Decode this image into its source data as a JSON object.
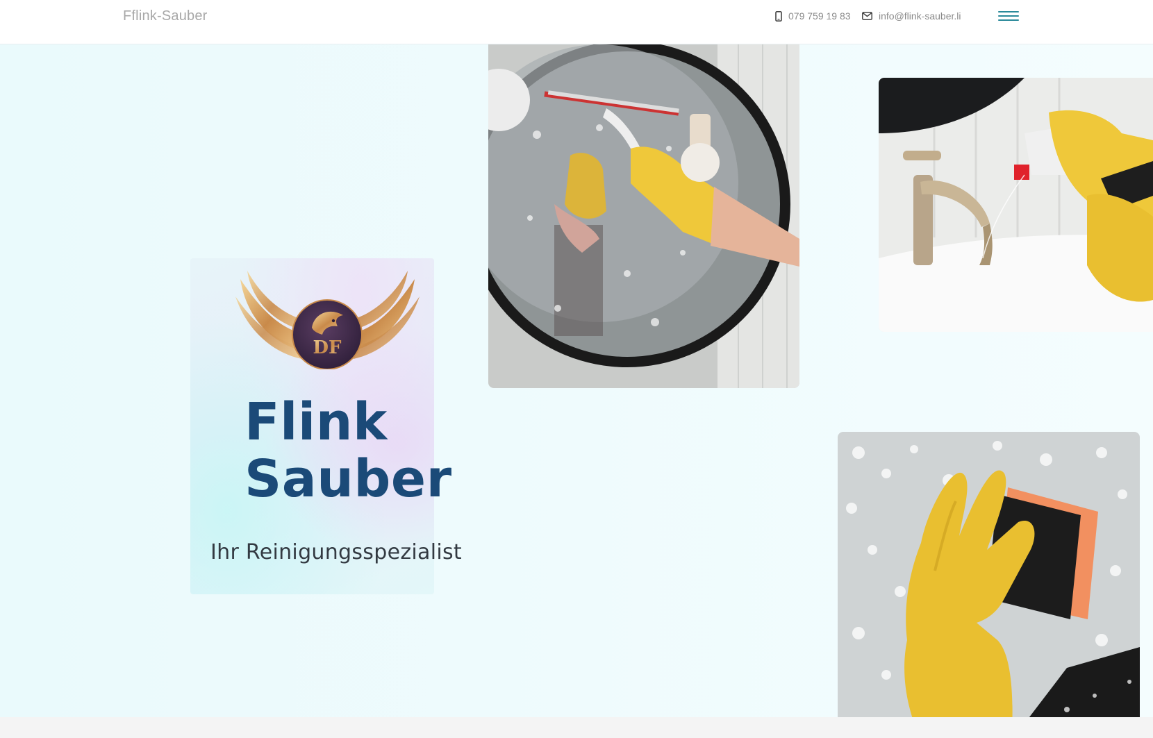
{
  "header": {
    "brand": "Fflink-Sauber",
    "phone": "079 759 19 83",
    "email": "info@flink-sauber.li",
    "phone_icon": "mobile-phone-icon",
    "email_icon": "envelope-icon",
    "menu_icon": "hamburger-menu-icon"
  },
  "hero": {
    "title": "Flink\nSauber",
    "subtitle": "Ihr Reinigungsspezialist",
    "logo_letters": "DF",
    "images": [
      "mirror-cleaning-photo",
      "faucet-spray-photo",
      "sponge-glass-photo"
    ]
  },
  "colors": {
    "title": "#1b4a78",
    "accent": "#2b8a9a",
    "hero_bg": "#effbfd",
    "glove": "#f0c832",
    "gold": "#d9a562",
    "logo_circle": "#3e2a4c"
  }
}
